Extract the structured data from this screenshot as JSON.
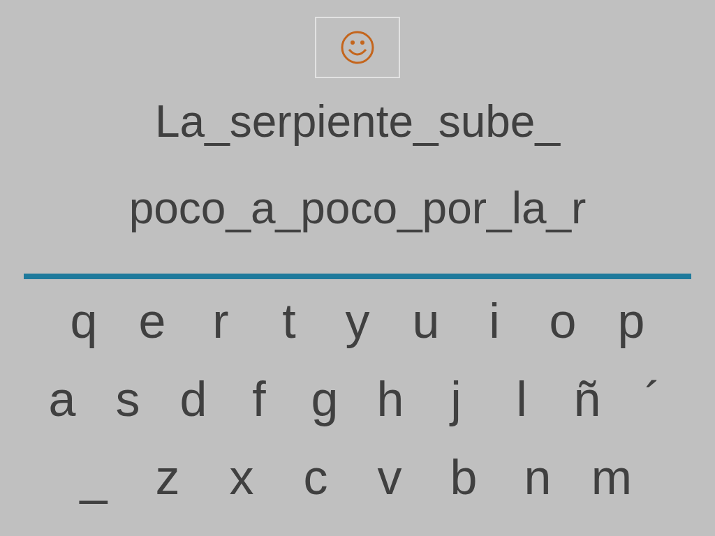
{
  "sentence_lines": [
    "La_serpiente_sube_",
    "poco_a_poco_por_la_r"
  ],
  "keyboard_rows": [
    [
      "q",
      "e",
      "r",
      "t",
      "y",
      "u",
      "i",
      "o",
      "p"
    ],
    [
      "a",
      "s",
      "d",
      "f",
      "g",
      "h",
      "j",
      "l",
      "ñ",
      "´"
    ],
    [
      "_",
      "z",
      "x",
      "c",
      "v",
      "b",
      "n",
      "m"
    ]
  ]
}
